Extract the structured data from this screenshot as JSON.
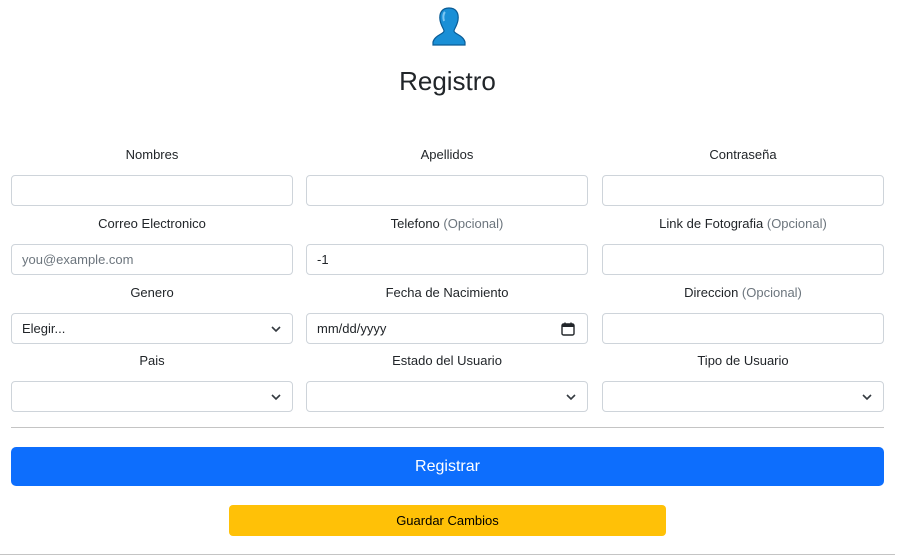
{
  "header": {
    "title": "Registro"
  },
  "form": {
    "nombres": {
      "label": "Nombres",
      "value": ""
    },
    "apellidos": {
      "label": "Apellidos",
      "value": ""
    },
    "contrasena": {
      "label": "Contraseña",
      "value": ""
    },
    "correo": {
      "label": "Correo Electronico",
      "placeholder": "you@example.com",
      "value": ""
    },
    "telefono": {
      "label": "Telefono",
      "optional": "(Opcional)",
      "value": "-1"
    },
    "foto": {
      "label": "Link de Fotografia",
      "optional": "(Opcional)",
      "value": ""
    },
    "genero": {
      "label": "Genero",
      "selected": "Elegir..."
    },
    "nacimiento": {
      "label": "Fecha de Nacimiento",
      "placeholder": "mm/dd/yyyy"
    },
    "direccion": {
      "label": "Direccion",
      "optional": "(Opcional)",
      "value": ""
    },
    "pais": {
      "label": "Pais",
      "selected": ""
    },
    "estado": {
      "label": "Estado del Usuario",
      "selected": ""
    },
    "tipo": {
      "label": "Tipo de Usuario",
      "selected": ""
    }
  },
  "actions": {
    "register_label": "Registrar",
    "save_label": "Guardar Cambios"
  },
  "colors": {
    "primary": "#0d6efd",
    "warning": "#ffc107",
    "border": "#ced4da",
    "muted": "#6c757d"
  },
  "icons": {
    "avatar": "user-avatar-icon",
    "select": "chevron-down-icon",
    "date": "calendar-icon"
  }
}
